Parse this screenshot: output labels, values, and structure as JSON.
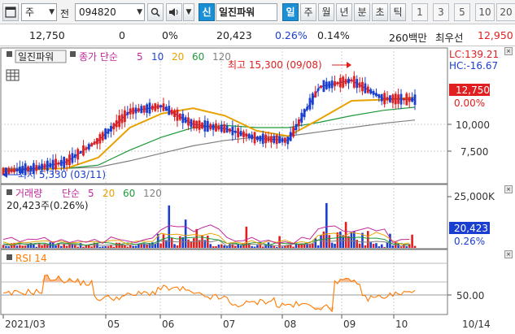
{
  "toolbar": {
    "market_select": "주",
    "prefix_label": "전",
    "code_value": "094820",
    "stock_badge": "신",
    "stock_name": "일진파워",
    "periods": [
      "일",
      "주",
      "월",
      "년",
      "분",
      "초",
      "틱"
    ],
    "active_period": "일",
    "minute_options": [
      "1",
      "3",
      "5",
      "10",
      "20"
    ]
  },
  "infobar": {
    "price": "12,750",
    "change": "0",
    "change_pct": "0%",
    "volume": "20,423",
    "volume_pct": "0.26%",
    "turnover_pct": "0.14%",
    "trade_value": "260백만",
    "best_ask_label": "최우선",
    "best_ask_value": "12,950"
  },
  "colors": {
    "up": "#e02020",
    "down": "#1a3fd0",
    "ma5": "#1e44d8",
    "ma20": "#e8a200",
    "ma60": "#1e9a3a",
    "ma120": "#808080",
    "rsi": "#ff7a00",
    "badge_blue": "#1b8fd6"
  },
  "price_panel": {
    "stock_name": "일진파워",
    "ma_label": "종가 단순",
    "ma_periods": [
      "5",
      "10",
      "20",
      "60",
      "120"
    ],
    "lc_label": "LC:139.21",
    "hc_label": "HC:-16.67",
    "current_price_tag": "12,750",
    "current_pct_tag": "0.00%",
    "y_ticks": [
      "10,000",
      "7,500"
    ],
    "y_tick_values": [
      10000,
      7500
    ],
    "high_note": "최고 15,300 (09/08)",
    "low_note": "최저 5,330 (03/11)"
  },
  "volume_panel": {
    "title": "거래량",
    "ma_label": "단순",
    "ma_periods": [
      "5",
      "20",
      "60",
      "120"
    ],
    "current_text": "20,423주(0.26%)",
    "y_tick": "25,000K",
    "y_tick_value": 25000,
    "value_tag": "20,423",
    "pct_tag": "0.26%"
  },
  "rsi_panel": {
    "title": "RSI 14",
    "y_tick": "50.00",
    "y_tick_value": 50
  },
  "x_axis": {
    "labels": [
      "2021/03",
      "05",
      "06",
      "07",
      "08",
      "09",
      "10",
      "10/14"
    ]
  },
  "chart_data": {
    "type": "candlestick",
    "x": [
      "2021/03",
      "05",
      "06",
      "07",
      "08",
      "09",
      "10"
    ],
    "ma5": [
      5600,
      5900,
      6500,
      8500,
      11200,
      11700,
      10000,
      9600,
      8700,
      8500,
      13500,
      14100,
      12400,
      12300
    ],
    "ma20": [
      5700,
      5800,
      5900,
      6900,
      9700,
      11000,
      11500,
      10800,
      9400,
      8900,
      10500,
      12200,
      12300,
      12500
    ],
    "ma60": [
      5800,
      5800,
      5900,
      6200,
      7600,
      8800,
      9700,
      9900,
      9700,
      9700,
      10200,
      10800,
      11300,
      11600
    ],
    "ma120": [
      5900,
      5900,
      5900,
      6000,
      6600,
      7300,
      8000,
      8500,
      8800,
      8900,
      9300,
      9700,
      10100,
      10400
    ],
    "price_high": 15300,
    "price_low": 5330,
    "last_close": 12750,
    "last_volume_shares": 20423,
    "rsi_reference": 50
  }
}
